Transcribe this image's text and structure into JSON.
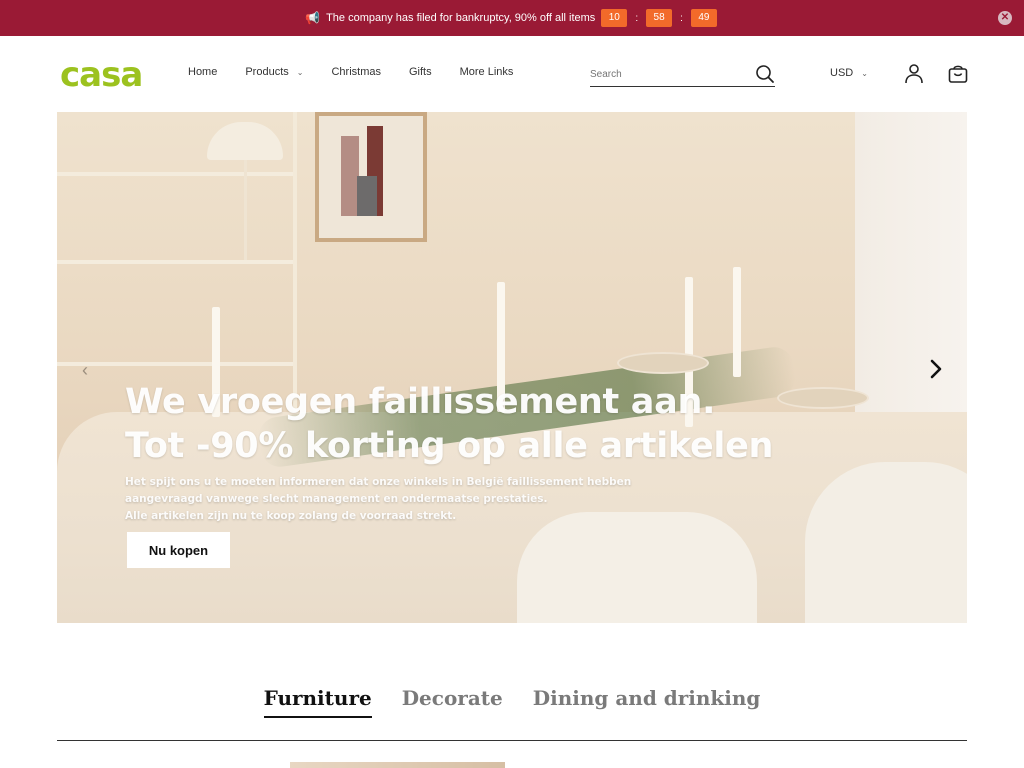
{
  "announcement": {
    "icon": "megaphone-icon",
    "message": "The company has filed for bankruptcy, 90% off all items",
    "countdown": [
      "10",
      "58",
      "49"
    ],
    "separator": ":",
    "close_icon": "close-icon"
  },
  "header": {
    "logo": "casa",
    "nav": [
      {
        "label": "Home"
      },
      {
        "label": "Products"
      },
      {
        "label": "Christmas"
      },
      {
        "label": "Gifts"
      },
      {
        "label": "More Links"
      }
    ],
    "search": {
      "placeholder": "Search"
    },
    "currency": "USD"
  },
  "hero": {
    "title_line1": "We vroegen faillissement aan.",
    "title_line2": "Tot -90% korting op alle artikelen",
    "sub_line1": "Het spijt ons u te moeten informeren dat onze winkels in België faillissement hebben",
    "sub_line2": "aangevraagd vanwege slecht management en ondermaatse prestaties.",
    "sub_line3": " Alle artikelen zijn nu te koop zolang de voorraad strekt.",
    "button": "Nu kopen"
  },
  "tabs": [
    {
      "label": "Furniture",
      "active": true
    },
    {
      "label": "Decorate",
      "active": false
    },
    {
      "label": "Dining and drinking",
      "active": false
    }
  ],
  "colors": {
    "announcement_bg": "#9a1a35",
    "countdown_bg": "#f26a2a",
    "logo": "#9cc21f"
  }
}
